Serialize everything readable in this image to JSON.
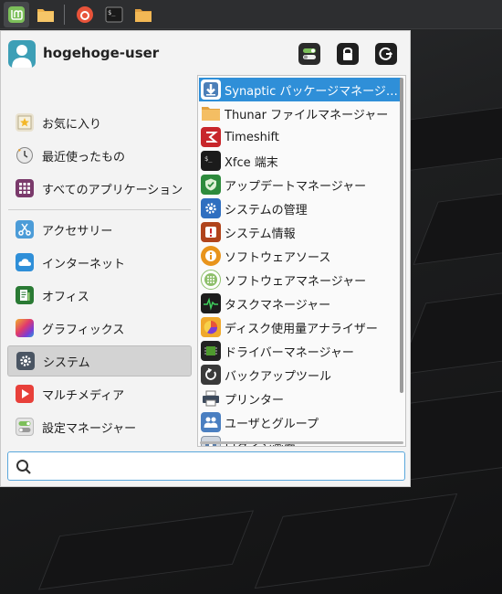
{
  "user": {
    "name": "hogehoge-user"
  },
  "left_menu": [
    {
      "label": "お気に入り",
      "icon": "star-icon"
    },
    {
      "label": "最近使ったもの",
      "icon": "clock-icon"
    },
    {
      "label": "すべてのアプリケーション",
      "icon": "grid-icon"
    },
    {
      "label": "アクセサリー",
      "icon": "scissors-icon"
    },
    {
      "label": "インターネット",
      "icon": "cloud-icon"
    },
    {
      "label": "オフィス",
      "icon": "document-icon"
    },
    {
      "label": "グラフィックス",
      "icon": "palette-icon"
    },
    {
      "label": "システム",
      "icon": "gear-icon",
      "active": true
    },
    {
      "label": "マルチメディア",
      "icon": "play-icon"
    },
    {
      "label": "設定マネージャー",
      "icon": "toggle-icon"
    }
  ],
  "apps": [
    {
      "label": "Synaptic パッケージマネージ…",
      "icon": "download-arrow-icon",
      "selected": true
    },
    {
      "label": "Thunar ファイルマネージャー",
      "icon": "folder-icon"
    },
    {
      "label": "Timeshift",
      "icon": "timeshift-icon"
    },
    {
      "label": "Xfce 端末",
      "icon": "terminal-icon"
    },
    {
      "label": "アップデートマネージャー",
      "icon": "shield-icon"
    },
    {
      "label": "システムの管理",
      "icon": "gear-icon"
    },
    {
      "label": "システム情報",
      "icon": "exclamation-icon"
    },
    {
      "label": "ソフトウェアソース",
      "icon": "info-icon"
    },
    {
      "label": "ソフトウェアマネージャー",
      "icon": "dots-grid-icon"
    },
    {
      "label": "タスクマネージャー",
      "icon": "activity-graph-icon"
    },
    {
      "label": "ディスク使用量アナライザー",
      "icon": "disk-chart-icon"
    },
    {
      "label": "ドライバーマネージャー",
      "icon": "chip-icon"
    },
    {
      "label": "バックアップツール",
      "icon": "backup-icon"
    },
    {
      "label": "プリンター",
      "icon": "printer-icon"
    },
    {
      "label": "ユーザとグループ",
      "icon": "users-icon"
    },
    {
      "label": "ログイン画面",
      "icon": "login-screen-icon"
    }
  ],
  "search": {
    "placeholder": "",
    "value": ""
  },
  "colors": {
    "accent": "#2f8fd8",
    "menu_bg": "#f3f3f3",
    "panel_bg": "#2d2e30"
  }
}
